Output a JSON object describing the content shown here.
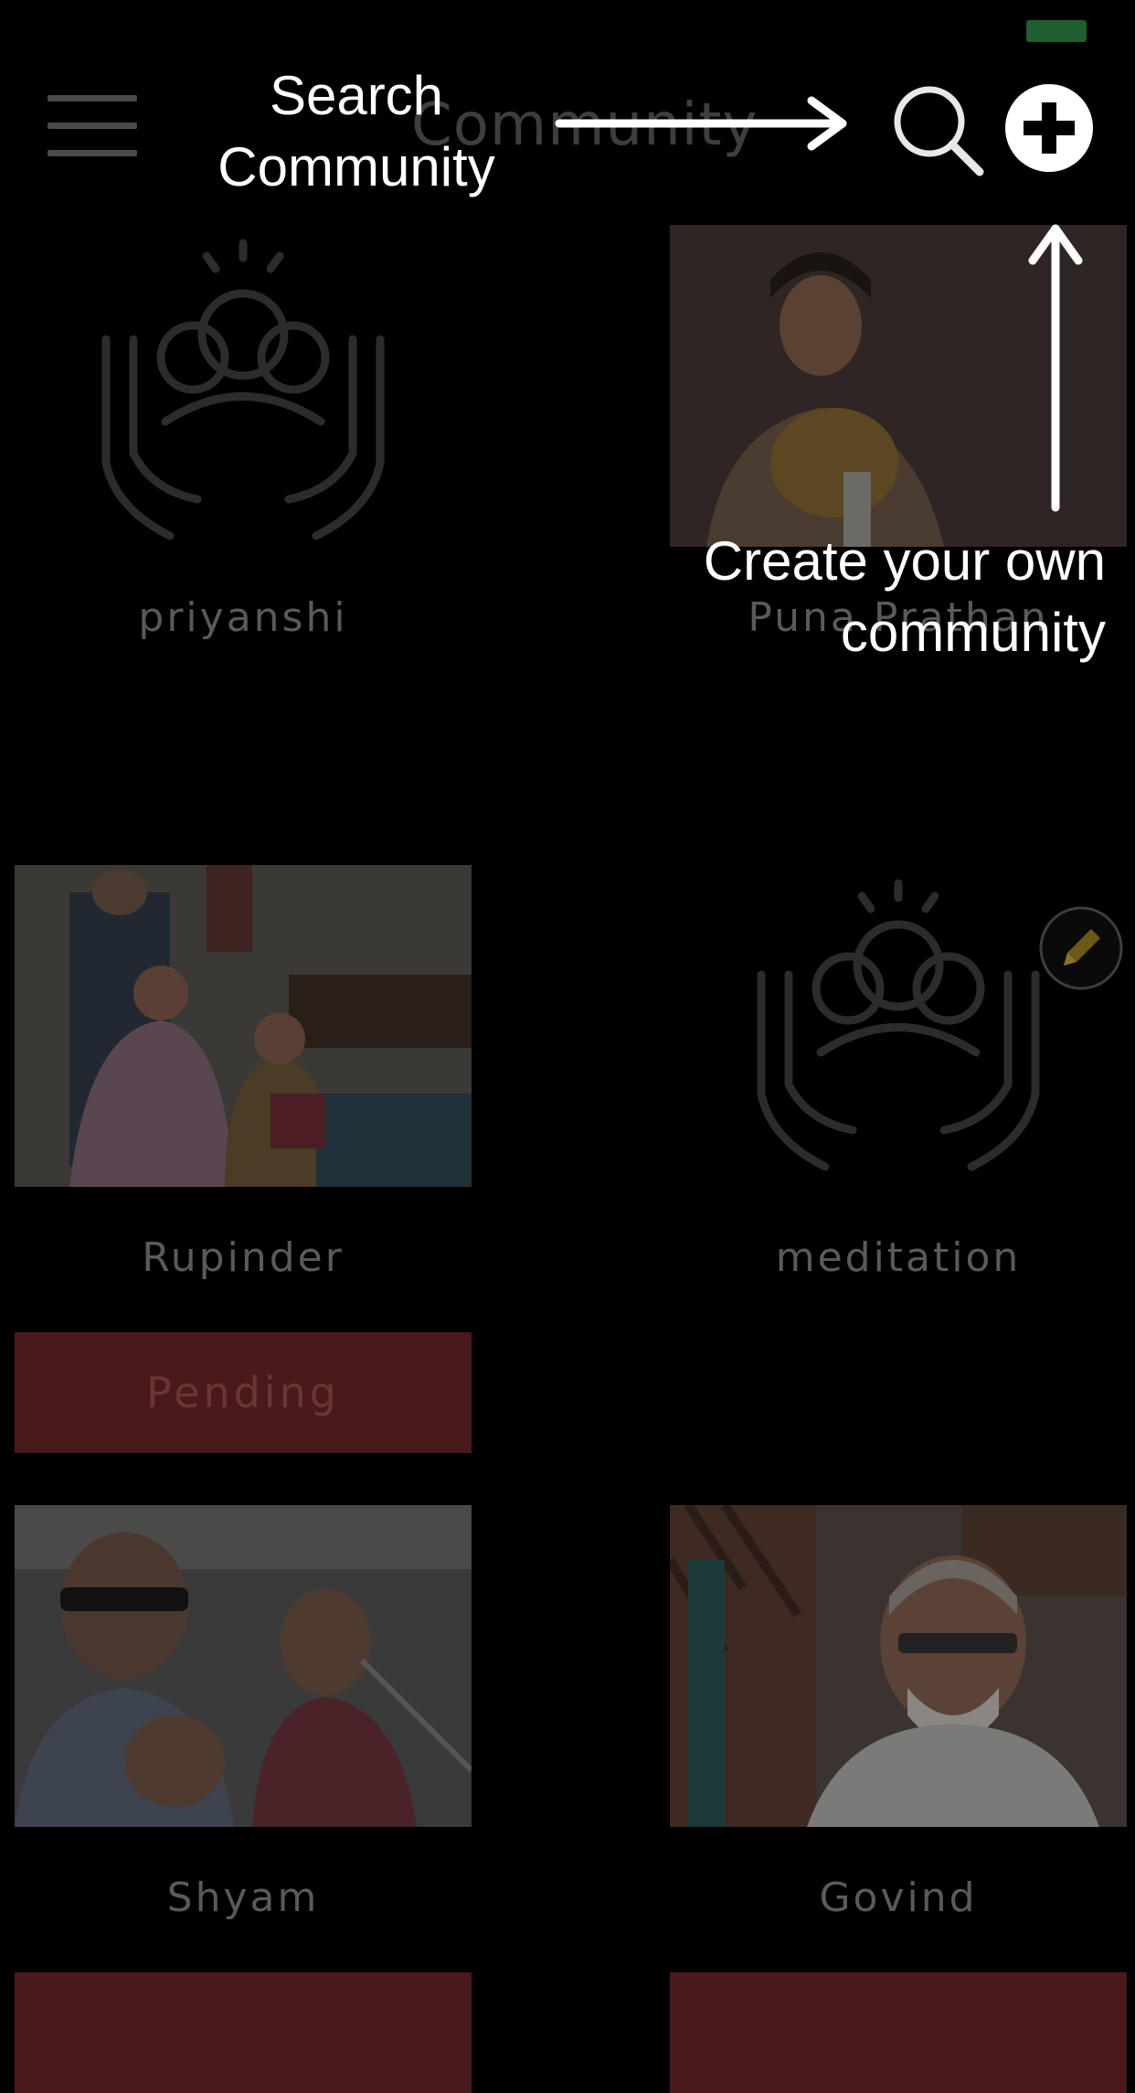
{
  "header": {
    "title": "Community",
    "menu_icon": "hamburger-menu-icon",
    "search_icon": "search-icon",
    "add_icon": "plus-circle-icon"
  },
  "communities": [
    {
      "name": "priyanshi",
      "image": "community-placeholder-icon"
    },
    {
      "name": "Puna Prathan",
      "image": "photo"
    },
    {
      "name": "Rupinder",
      "image": "photo",
      "status": "Pending"
    },
    {
      "name": "meditation",
      "image": "community-placeholder-icon",
      "edit_icon": "pencil-icon"
    },
    {
      "name": "Shyam",
      "image": "photo"
    },
    {
      "name": "Govind",
      "image": "photo"
    }
  ],
  "overlay": {
    "search_tip": "Search Community",
    "create_tip": "Create your own community"
  },
  "colors": {
    "background": "#000000",
    "pending_button": "#4a1919",
    "edit_accent": "#c8a51a",
    "status_indicator": "#1e5e30"
  }
}
